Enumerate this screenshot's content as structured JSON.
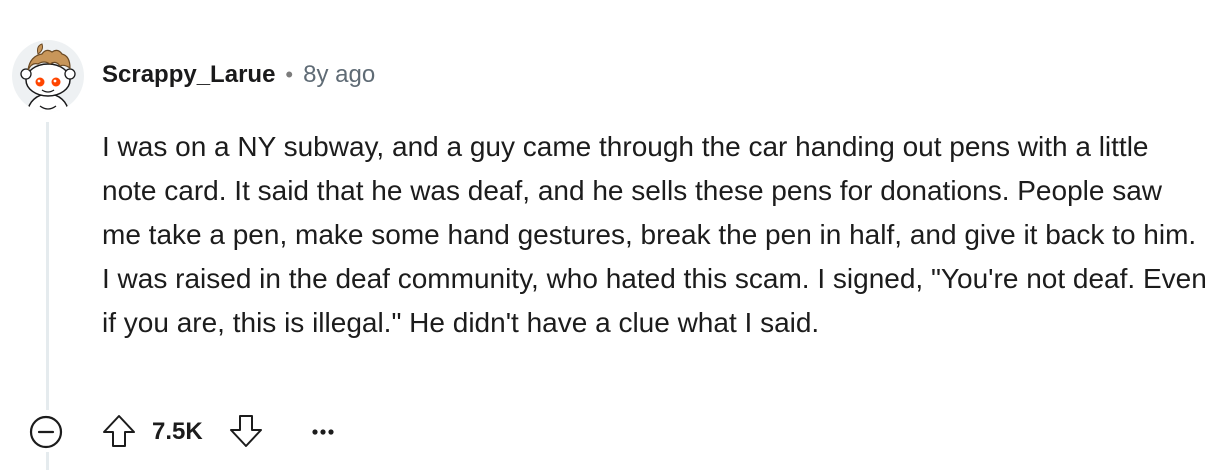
{
  "comment": {
    "username": "Scrappy_Larue",
    "separator": "•",
    "timestamp": "8y ago",
    "text": "I was on a NY subway, and a guy came through the car handing out pens with a little note card. It said that he was deaf, and he sells these pens for donations. People saw me take a pen, make some hand gestures, break the pen in half, and give it back to him. I was raised in the deaf community, who hated this scam. I signed, \"You're not deaf. Even if you are, this is illegal.\" He didn't have a clue what I said.",
    "score": "7.5K"
  },
  "icons": {
    "collapse": "minus-circle-icon",
    "upvote": "arrow-up-icon",
    "downvote": "arrow-down-icon",
    "more": "more-dots-icon",
    "avatar": "snoo-avatar"
  },
  "colors": {
    "thread_line": "#e5ebee",
    "timestamp": "#5f6b75",
    "text": "#1c1c1c"
  }
}
